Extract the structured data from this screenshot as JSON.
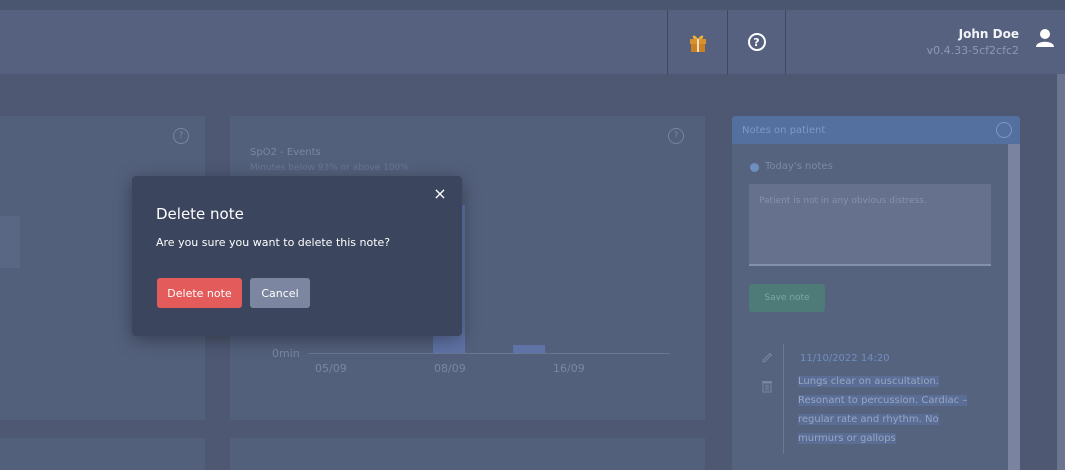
{
  "header": {
    "user_name": "John Doe",
    "version": "v0.4.33-5cf2cfc2",
    "help_glyph": "?",
    "icons": [
      "gift-icon",
      "help-icon",
      "user-icon"
    ]
  },
  "background": {
    "chart": {
      "title": "SpO2 - Events",
      "subtitle": "Minutes below 93% or above 100%",
      "y_tick": "0min",
      "x_ticks": [
        "05/09",
        "08/09",
        "16/09"
      ]
    },
    "notes": {
      "header": "Notes on patient",
      "section": "Today's notes",
      "textarea_placeholder": "Patient is not in any obvious distress.",
      "save_label": "Save note",
      "entry": {
        "timestamp": "11/10/2022 14:20",
        "lines": [
          "Lungs clear on auscultation.",
          "Resonant to percussion. Cardiac –",
          "regular rate and rhythm. No",
          "murmurs or gallops"
        ]
      }
    }
  },
  "modal": {
    "title": "Delete note",
    "message": "Are you sure you want to delete this note?",
    "close_glyph": "×",
    "delete_label": "Delete note",
    "cancel_label": "Cancel"
  },
  "colors": {
    "overlay": "#4a5570",
    "modal_bg": "#3b465e",
    "danger": "#e35b5b",
    "secondary": "#7c86a0",
    "accent": "#53709e"
  }
}
